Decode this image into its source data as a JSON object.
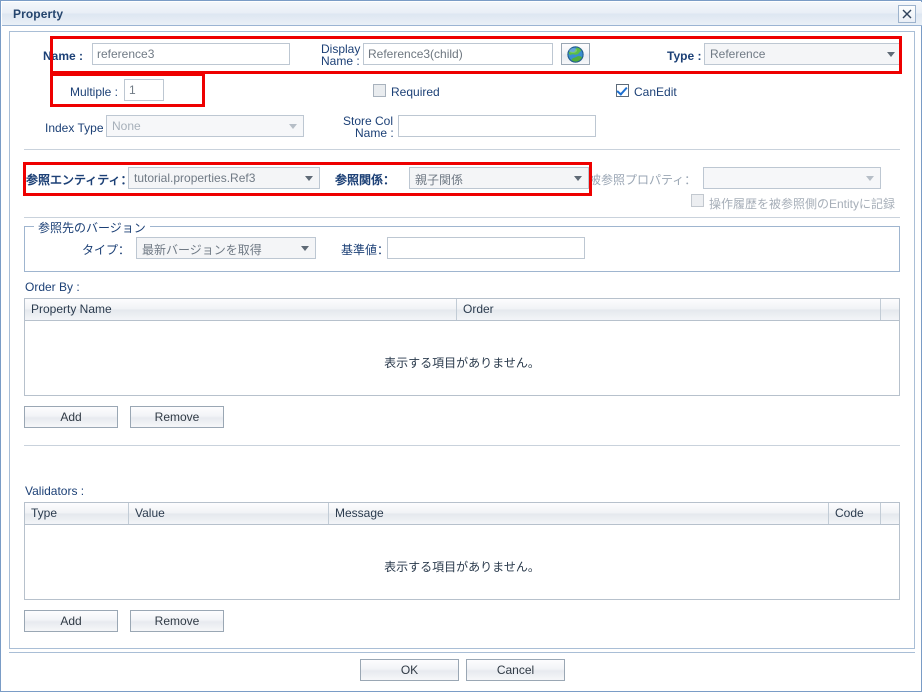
{
  "window": {
    "title": "Property",
    "close_icon": "close-icon"
  },
  "form": {
    "name_label": "Name :",
    "name_value": "reference3",
    "display_name_label_line1": "Display",
    "display_name_label_line2": "Name :",
    "display_name_value": "Reference3(child)",
    "globe_icon": "globe-icon",
    "type_label": "Type :",
    "type_value": "Reference",
    "multiple_label": "Multiple :",
    "multiple_value": "1",
    "required_label": "Required",
    "required_checked": false,
    "canedit_label": "CanEdit",
    "canedit_checked": true,
    "index_type_label": "Index Type :",
    "index_type_value": "None",
    "store_col_label_line1": "Store Col",
    "store_col_label_line2": "Name :",
    "store_col_value": "",
    "ref_entity_label": "参照エンティティ：",
    "ref_entity_value": "tutorial.properties.Ref3",
    "ref_relation_label": "参照関係：",
    "ref_relation_value": "親子関係",
    "referenced_prop_label": "被参照プロパティ：",
    "referenced_prop_value": "",
    "history_checkbox_label": "操作履歴を被参照側のEntityに記録",
    "history_checked": false
  },
  "version_group": {
    "title": "参照先のバージョン",
    "type_label": "タイプ：",
    "type_value": "最新バージョンを取得",
    "base_label": "基準値：",
    "base_value": ""
  },
  "order_by": {
    "label": "Order By :",
    "columns": [
      "Property Name",
      "Order"
    ],
    "empty_message": "表示する項目がありません。",
    "add_label": "Add",
    "remove_label": "Remove"
  },
  "validators": {
    "label": "Validators :",
    "columns": [
      "Type",
      "Value",
      "Message",
      "Code"
    ],
    "empty_message": "表示する項目がありません。",
    "add_label": "Add",
    "remove_label": "Remove"
  },
  "footer": {
    "ok_label": "OK",
    "cancel_label": "Cancel"
  },
  "colors": {
    "label": "#1c4076",
    "annotation": "#ee0000",
    "border": "#a9bed6"
  }
}
